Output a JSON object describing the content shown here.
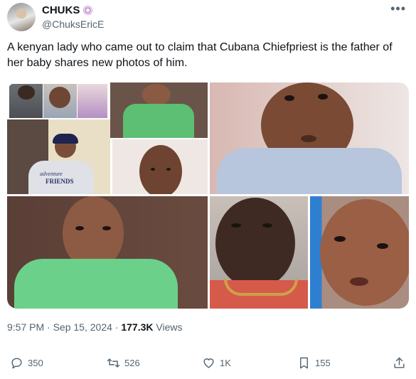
{
  "tweet": {
    "author_name": "CHUKS",
    "author_handle": "@ChuksEricE",
    "text": "A kenyan lady who came out to claim that Cubana Chiefpriest is the father of her baby shares new photos of him.",
    "time": "9:57 PM",
    "date": "Sep 15, 2024",
    "separator": "·",
    "views_count": "177.3K",
    "views_label": "Views"
  },
  "photo_texts": {
    "shirt_line1": "adventure",
    "shirt_line2": "FRIENDS"
  },
  "actions": {
    "reply_count": "350",
    "retweet_count": "526",
    "like_count": "1K",
    "bookmark_count": "155"
  },
  "icons": {
    "more": "more-icon",
    "verified": "badge-icon",
    "reply": "reply-icon",
    "retweet": "retweet-icon",
    "like": "heart-icon",
    "bookmark": "bookmark-icon",
    "share": "share-icon"
  },
  "colors": {
    "text": "#0f1419",
    "secondary": "#536471",
    "background": "#ffffff"
  }
}
